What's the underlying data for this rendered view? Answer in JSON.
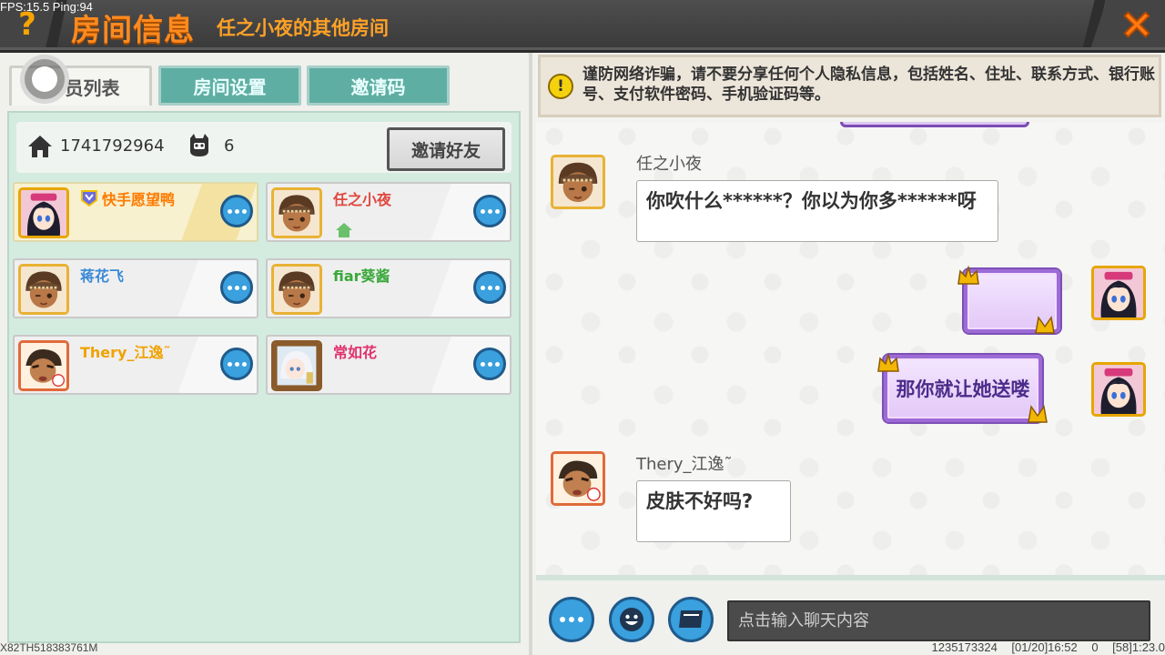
{
  "debug": {
    "fps": "FPS:15.5  Ping:94"
  },
  "header": {
    "help_label": "?",
    "title": "房间信息",
    "subtitle": "任之小夜的其他房间"
  },
  "tabs": [
    {
      "label": "成员列表",
      "active": true
    },
    {
      "label": "房间设置",
      "active": false
    },
    {
      "label": "邀请码",
      "active": false
    }
  ],
  "tab_active_visible": "员列表",
  "room": {
    "id": "1741792964",
    "player_count": "6",
    "invite_label": "邀请好友"
  },
  "members": [
    {
      "name": "快手愿望鸭",
      "color": "#ff7a00",
      "vip": true,
      "highlight": true,
      "avatar": "girl"
    },
    {
      "name": "任之小夜",
      "color": "#e0483f",
      "owner": true,
      "avatar": "tanboy"
    },
    {
      "name": "蒋花飞",
      "color": "#3a8ad6",
      "avatar": "tanboy"
    },
    {
      "name": "fiar葵酱",
      "color": "#3aa83a",
      "avatar": "tanboy"
    },
    {
      "name": "Thery_江逸˜",
      "color": "#f0a200",
      "avatar": "redboy"
    },
    {
      "name": "常如花",
      "color": "#e0336d",
      "avatar": "whitehair"
    }
  ],
  "device_id": "X82TH518383761M",
  "notice": {
    "icon": "!",
    "text": "谨防网络诈骗，请不要分享任何个人隐私信息，包括姓名、住址、联系方式、银行账号、支付软件密码、手机验证码等。"
  },
  "chat": [
    {
      "sender": "任之小夜",
      "text": "你吹什么******？你以为你多******呀",
      "side": "left"
    },
    {
      "sender": "",
      "text": "",
      "side": "right"
    },
    {
      "sender": "",
      "text": "那你就让她送喽",
      "side": "right"
    },
    {
      "sender": "Thery_江逸˜",
      "text": "皮肤不好吗?",
      "side": "left"
    }
  ],
  "input": {
    "placeholder": "点击输入聊天内容"
  },
  "status": {
    "text": "1235173324  [01/20]16:52 0  [58]1:23.0"
  },
  "colors": {
    "accent_orange": "#ff8a1e",
    "teal_tab": "#5faea3",
    "button_blue": "#3aa0de"
  }
}
